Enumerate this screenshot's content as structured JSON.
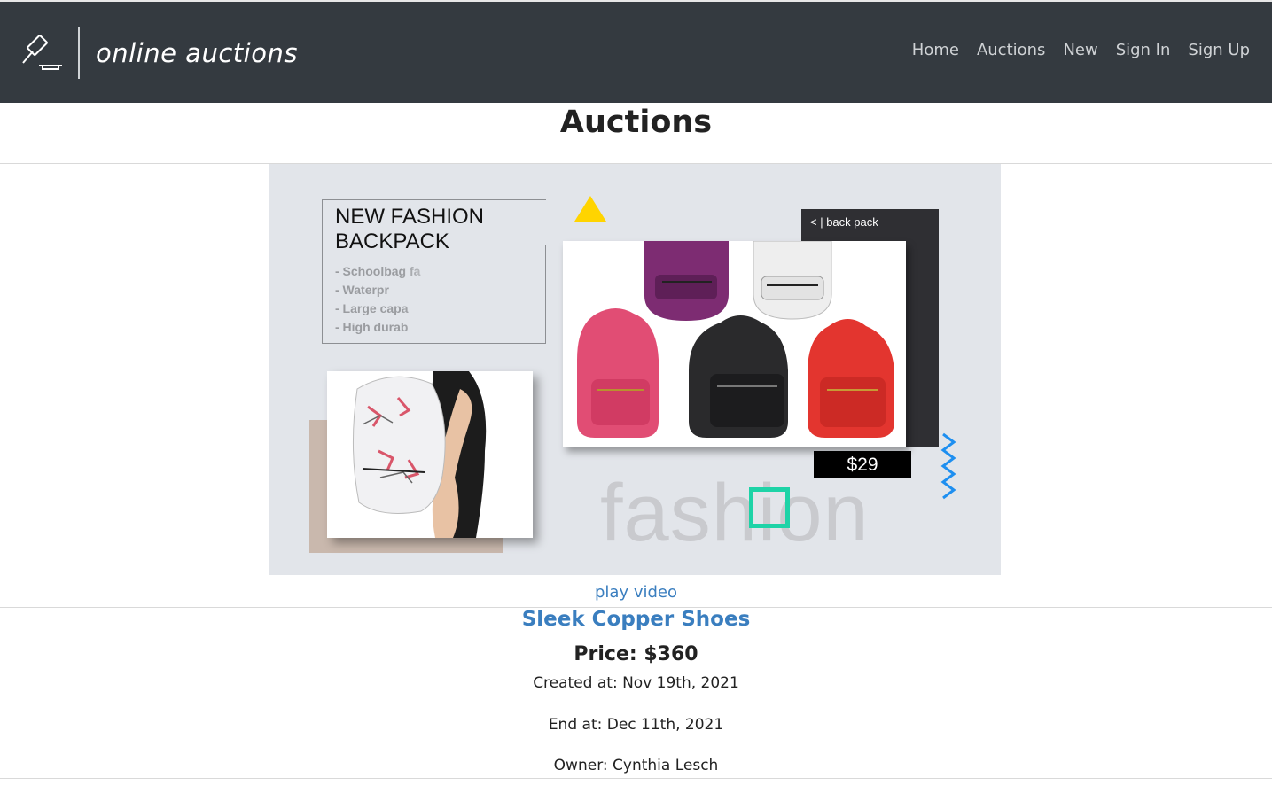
{
  "navbar": {
    "brand": "online auctions",
    "links": [
      "Home",
      "Auctions",
      "New",
      "Sign In",
      "Sign Up"
    ]
  },
  "page": {
    "title": "Auctions"
  },
  "media": {
    "card_title": "NEW FASHION BACKPACK",
    "card_title_line1": "NEW FASHION",
    "card_title_line2": "BACKPACK",
    "bullets": [
      "- Schoolbag fa",
      "- Waterpr",
      "- Large capa",
      "- High durab"
    ],
    "back_label": "<  |  back pack",
    "price_tag": "$29",
    "watermark": "fashion",
    "play_label": "play video",
    "colors": {
      "triangle": "#ffd400",
      "square": "#1ed3a7",
      "zigzag": "#1e8ff0"
    }
  },
  "auction": {
    "title": "Sleek Copper Shoes",
    "price": "Price: $360",
    "created": "Created at: Nov 19th, 2021",
    "end": "End at: Dec 11th, 2021",
    "owner": "Owner: Cynthia Lesch"
  }
}
